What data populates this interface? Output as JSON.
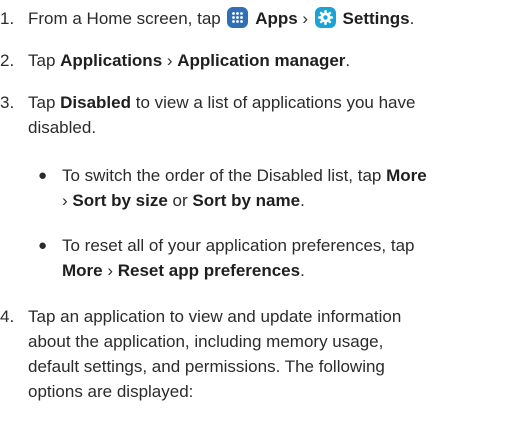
{
  "steps": [
    {
      "num": "1.",
      "pre": "From a Home screen, tap ",
      "apps": "Apps",
      "sep": " › ",
      "settings": "Settings",
      "post": "."
    },
    {
      "num": "2.",
      "pre": "Tap ",
      "b1": "Applications",
      "sep": " › ",
      "b2": "Application manager",
      "post": "."
    },
    {
      "num": "3.",
      "pre": "Tap ",
      "b1": "Disabled",
      "post1": " to view a list of applications you have",
      "post2": "disabled."
    },
    {
      "num": "4.",
      "l1": "Tap an application to view and update information",
      "l2": "about the application, including memory usage,",
      "l3": "default settings, and permissions. The following",
      "l4": "options are displayed:"
    }
  ],
  "bullets": [
    {
      "dot": "●",
      "pre": "To switch the order of the Disabled list, tap ",
      "b1": "More",
      "sep": "› ",
      "b2": "Sort by size",
      "mid": " or ",
      "b3": "Sort by name",
      "post": "."
    },
    {
      "dot": "●",
      "pre": "To reset all of your application preferences, tap",
      "b1": "More",
      "sep": " › ",
      "b2": "Reset app preferences",
      "post": "."
    }
  ],
  "icons": {
    "apps": "apps-grid-icon",
    "settings": "settings-gear-icon"
  },
  "colors": {
    "apps_icon": "#2f6fb6",
    "settings_icon": "#1aa3d6",
    "text": "#2b2b2b"
  }
}
